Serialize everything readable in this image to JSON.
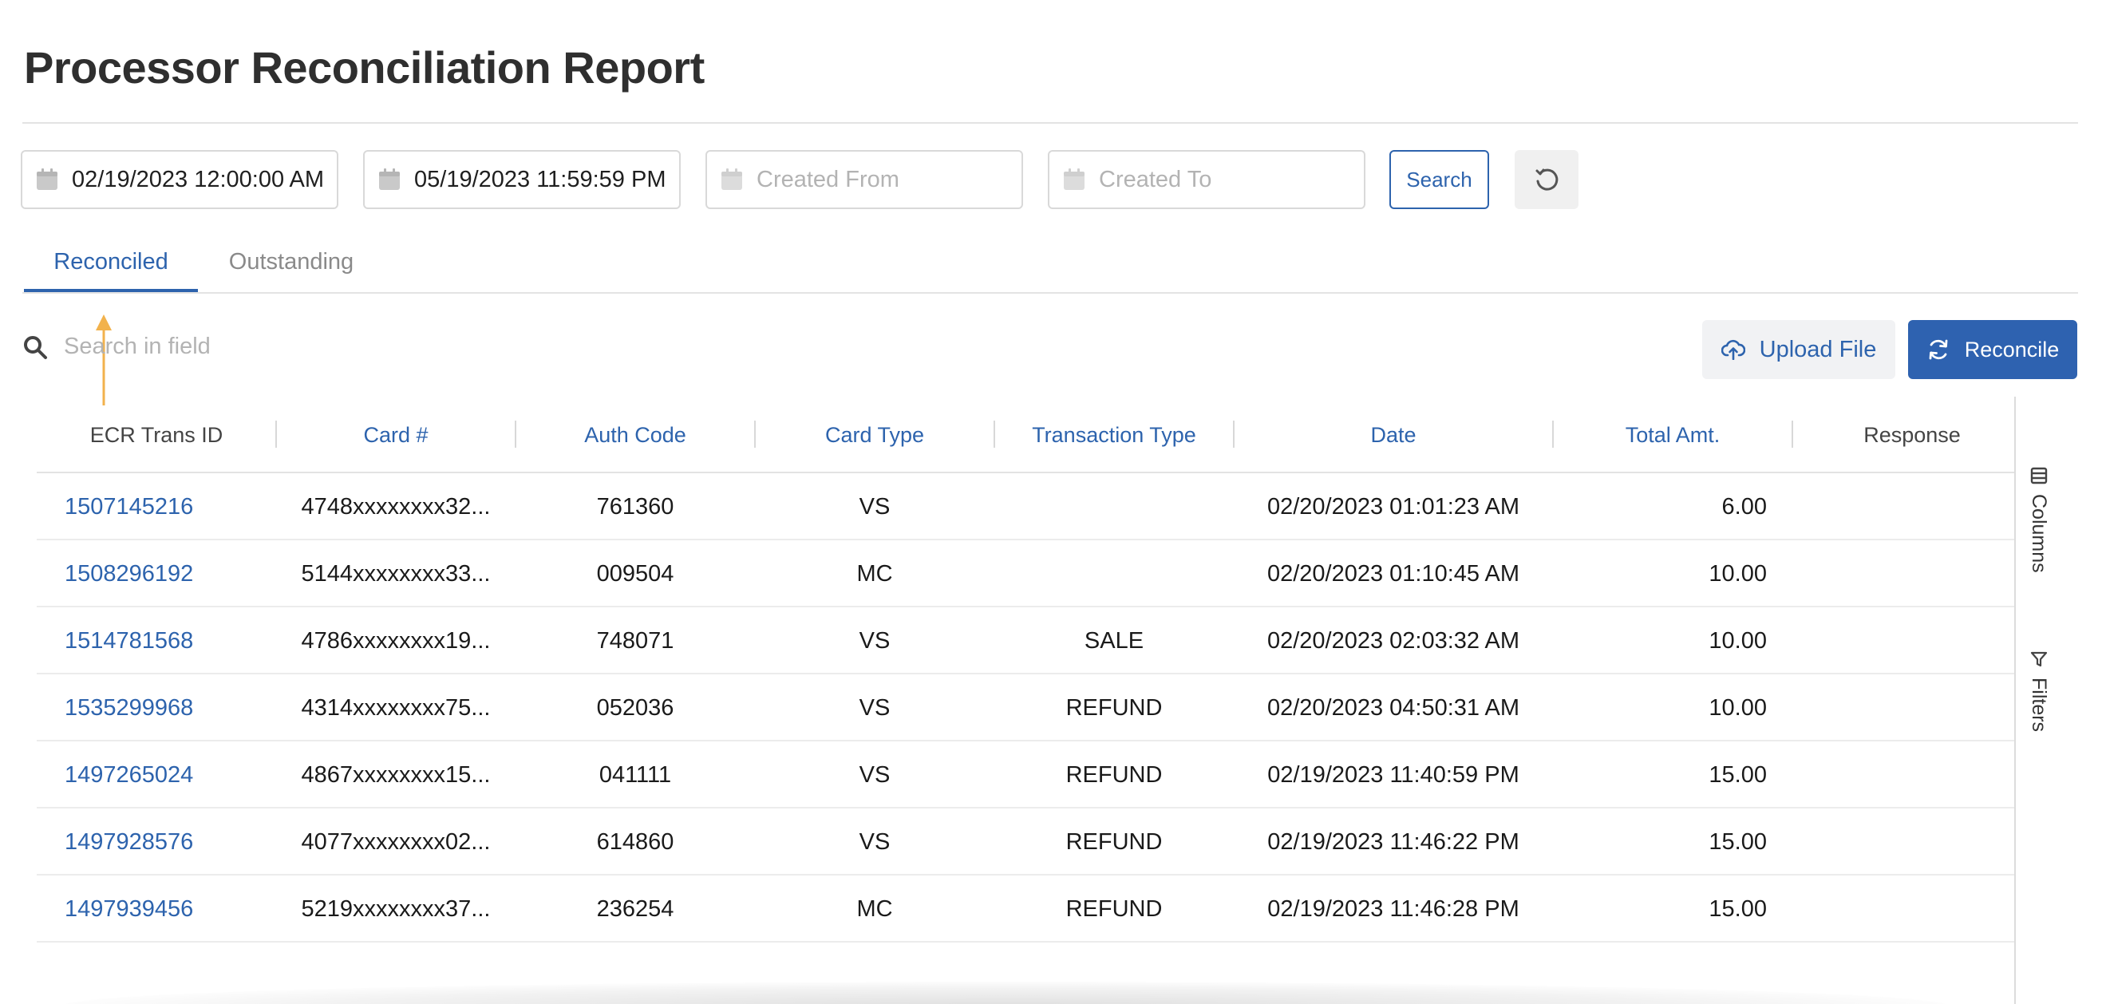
{
  "page": {
    "title": "Processor Reconciliation Report"
  },
  "filters": {
    "date_from": "02/19/2023 12:00:00 AM",
    "date_to": "05/19/2023 11:59:59 PM",
    "created_from_placeholder": "Created From",
    "created_to_placeholder": "Created To",
    "search_label": "Search",
    "reset_icon": "refresh-icon"
  },
  "tabs": [
    {
      "label": "Reconciled",
      "active": true
    },
    {
      "label": "Outstanding",
      "active": false
    }
  ],
  "toolbar": {
    "search_placeholder": "Search in field",
    "upload_label": "Upload File",
    "reconcile_label": "Reconcile"
  },
  "table": {
    "columns": [
      "ECR Trans ID",
      "Card #",
      "Auth Code",
      "Card Type",
      "Transaction Type",
      "Date",
      "Total Amt.",
      "Response"
    ],
    "rows": [
      {
        "ecr_trans_id": "1507145216",
        "card": "4748xxxxxxxx32...",
        "auth_code": "761360",
        "card_type": "VS",
        "transaction_type": "",
        "date": "02/20/2023 01:01:23 AM",
        "total_amt": "6.00",
        "response": ""
      },
      {
        "ecr_trans_id": "1508296192",
        "card": "5144xxxxxxxx33...",
        "auth_code": "009504",
        "card_type": "MC",
        "transaction_type": "",
        "date": "02/20/2023 01:10:45 AM",
        "total_amt": "10.00",
        "response": ""
      },
      {
        "ecr_trans_id": "1514781568",
        "card": "4786xxxxxxxx19...",
        "auth_code": "748071",
        "card_type": "VS",
        "transaction_type": "SALE",
        "date": "02/20/2023 02:03:32 AM",
        "total_amt": "10.00",
        "response": ""
      },
      {
        "ecr_trans_id": "1535299968",
        "card": "4314xxxxxxxx75...",
        "auth_code": "052036",
        "card_type": "VS",
        "transaction_type": "REFUND",
        "date": "02/20/2023 04:50:31 AM",
        "total_amt": "10.00",
        "response": ""
      },
      {
        "ecr_trans_id": "1497265024",
        "card": "4867xxxxxxxx15...",
        "auth_code": "041111",
        "card_type": "VS",
        "transaction_type": "REFUND",
        "date": "02/19/2023 11:40:59 PM",
        "total_amt": "15.00",
        "response": ""
      },
      {
        "ecr_trans_id": "1497928576",
        "card": "4077xxxxxxxx02...",
        "auth_code": "614860",
        "card_type": "VS",
        "transaction_type": "REFUND",
        "date": "02/19/2023 11:46:22 PM",
        "total_amt": "15.00",
        "response": ""
      },
      {
        "ecr_trans_id": "1497939456",
        "card": "5219xxxxxxxx37...",
        "auth_code": "236254",
        "card_type": "MC",
        "transaction_type": "REFUND",
        "date": "02/19/2023 11:46:28 PM",
        "total_amt": "15.00",
        "response": ""
      }
    ]
  },
  "side_panel": {
    "columns_label": "Columns",
    "filters_label": "Filters"
  },
  "colors": {
    "accent": "#2d63ad",
    "annotation_arrow": "#f2b24c"
  }
}
